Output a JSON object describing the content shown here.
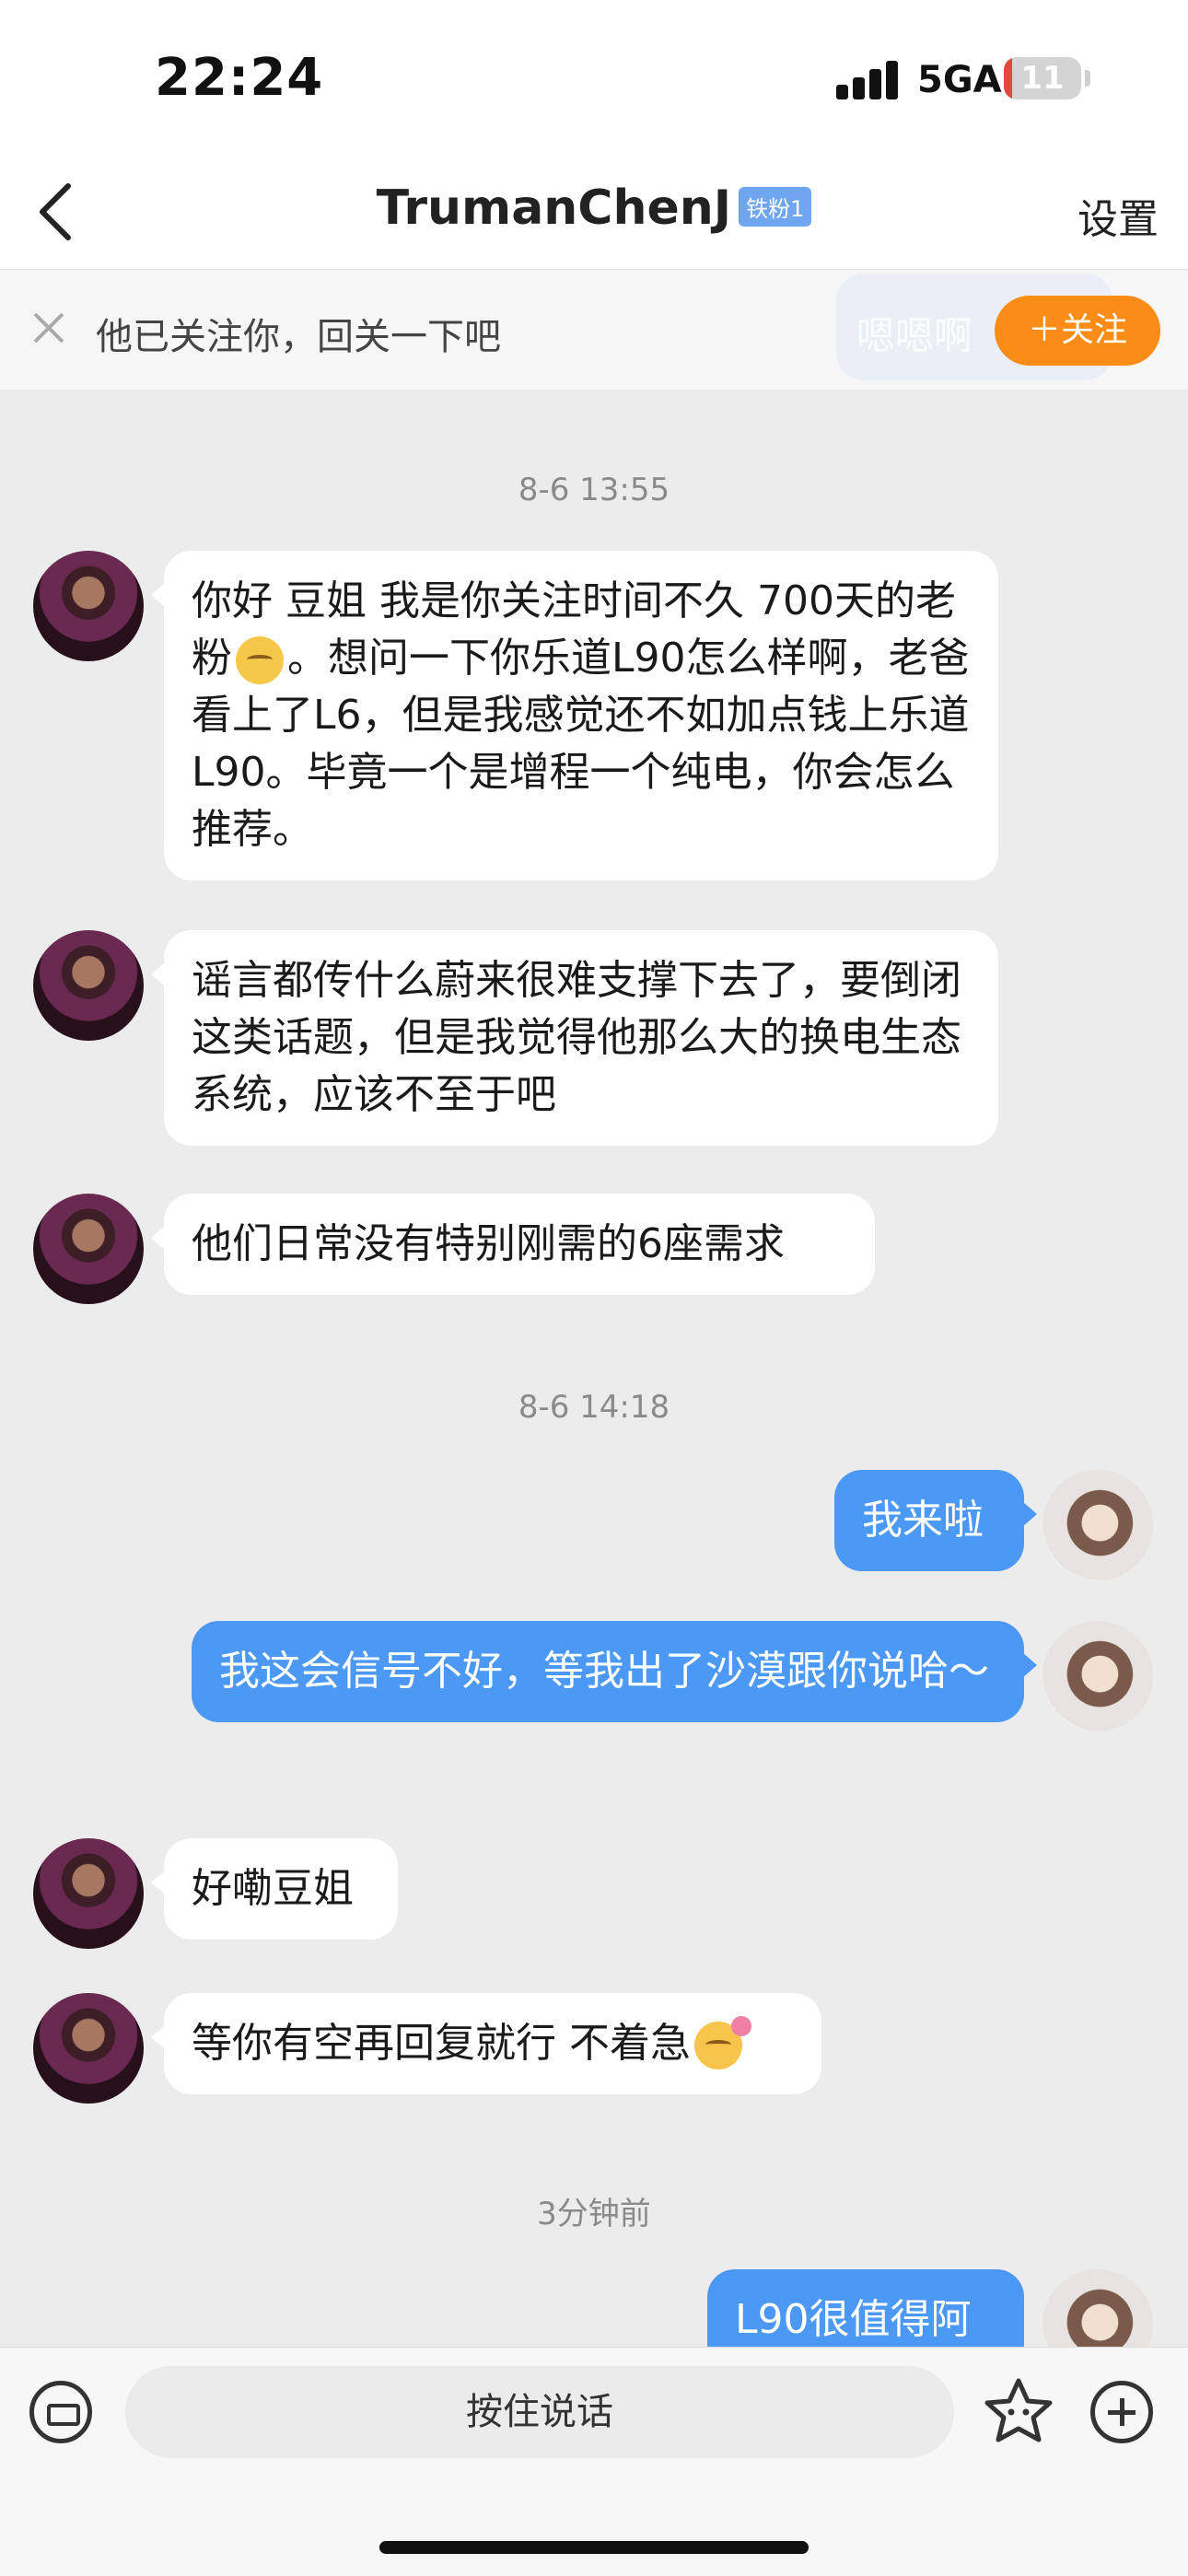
{
  "status_bar": {
    "time": "22:24",
    "network": "5GA",
    "battery": "11",
    "battery_level_percent": 11
  },
  "header": {
    "title": "TrumanChenJ",
    "fan_badge": "铁粉1",
    "settings_label": "设置"
  },
  "follow_bar": {
    "text": "他已关注你，回关一下吧",
    "ghost_text": "嗯嗯啊",
    "follow_button": "＋关注"
  },
  "messages": {
    "ts1": "8-6 13:55",
    "m1a": "你好 豆姐 我是你关注时间不久 700天的老粉",
    "m1b": "。想问一下你乐道L90怎么样啊，老爸看上了L6，但是我感觉还不如加点钱上乐道L90。毕竟一个是增程一个纯电，你会怎么推荐。",
    "m2": "谣言都传什么蔚来很难支撑下去了，要倒闭这类话题，但是我觉得他那么大的换电生态系统，应该不至于吧",
    "m3": "他们日常没有特别刚需的6座需求",
    "ts2": "8-6 14:18",
    "m4": "我来啦",
    "m5": "我这会信号不好，等我出了沙漠跟你说哈～",
    "m6": "好嘞豆姐",
    "m7": "等你有空再回复就行 不着急",
    "ts3": "3分钟前",
    "m8": "L90很值得阿"
  },
  "input": {
    "voice_label": "按住说话"
  },
  "colors": {
    "outgoing_bubble": "#4c98f5",
    "follow_button": "#fb8c16"
  }
}
